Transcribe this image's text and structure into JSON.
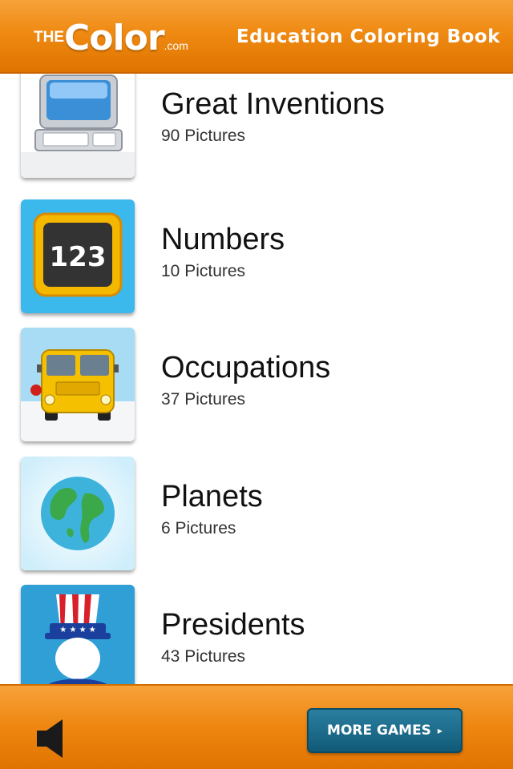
{
  "header": {
    "logo": {
      "prefix": "THE",
      "main": "Color",
      "suffix": ".com"
    },
    "title": "Education Coloring Book"
  },
  "categories": [
    {
      "name": "Great Inventions",
      "count": "90 Pictures",
      "icon": "computer-icon"
    },
    {
      "name": "Numbers",
      "count": "10 Pictures",
      "icon": "chalkboard-123-icon"
    },
    {
      "name": "Occupations",
      "count": "37 Pictures",
      "icon": "school-bus-icon"
    },
    {
      "name": "Planets",
      "count": "6 Pictures",
      "icon": "earth-icon"
    },
    {
      "name": "Presidents",
      "count": "43 Pictures",
      "icon": "uncle-sam-icon"
    }
  ],
  "numbers_icon_text": "123",
  "footer": {
    "sound_icon": "speaker-icon",
    "more_games_label": "MORE GAMES",
    "more_games_arrow": "▸"
  },
  "colors": {
    "header_orange": "#ef8a12",
    "button_teal": "#1d6e8e"
  }
}
